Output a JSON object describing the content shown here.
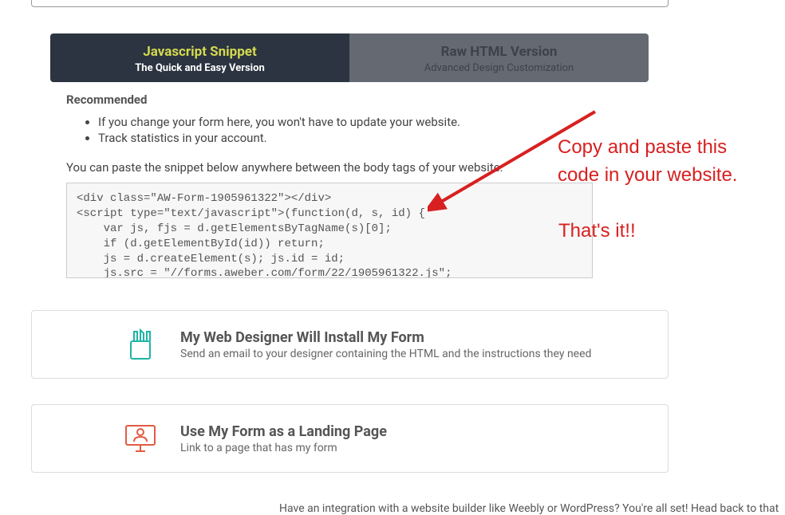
{
  "tabs": {
    "active": {
      "title": "Javascript Snippet",
      "subtitle": "The Quick and Easy Version"
    },
    "inactive": {
      "title": "Raw HTML Version",
      "subtitle": "Advanced Design Customization"
    }
  },
  "section": {
    "recommended": "Recommended",
    "bullet1": "If you change your form here, you won't have to update your website.",
    "bullet2": "Track statistics in your account.",
    "paste_instruction": "You can paste the snippet below anywhere between the body tags of your website:",
    "code": "<div class=\"AW-Form-1905961322\"></div>\n<script type=\"text/javascript\">(function(d, s, id) {\n    var js, fjs = d.getElementsByTagName(s)[0];\n    if (d.getElementById(id)) return;\n    js = d.createElement(s); js.id = id;\n    js.src = \"//forms.aweber.com/form/22/1905961322.js\";"
  },
  "annotation": {
    "line1": "Copy and paste this\ncode in your website.",
    "line2": "That's it!!"
  },
  "cards": {
    "designer": {
      "title": "My Web Designer Will Install My Form",
      "subtitle": "Send an email to your designer containing the HTML and the instructions they need"
    },
    "landing": {
      "title": "Use My Form as a Landing Page",
      "subtitle": "Link to a page that has my form"
    }
  },
  "cutoff": "Have an integration with a website builder like Weebly or WordPress? You're all set! Head back to that"
}
